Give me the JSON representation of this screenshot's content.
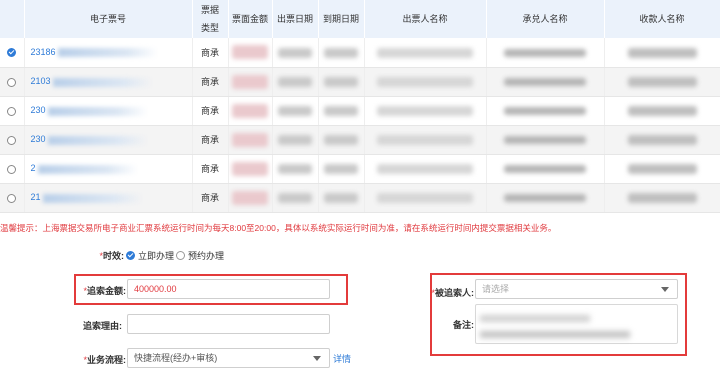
{
  "table": {
    "headers": [
      "",
      "电子票号",
      "票据类型",
      "票面金额",
      "出票日期",
      "到期日期",
      "出票人名称",
      "承兑人名称",
      "收款人名称"
    ],
    "rows": [
      {
        "bill_no": "23186",
        "type": "商承",
        "selected": true
      },
      {
        "bill_no": "2103",
        "type": "商承",
        "selected": false
      },
      {
        "bill_no": "230",
        "type": "商承",
        "selected": false
      },
      {
        "bill_no": "230",
        "type": "商承",
        "selected": false
      },
      {
        "bill_no": "2",
        "type": "商承",
        "selected": false
      },
      {
        "bill_no": "21",
        "type": "商承",
        "selected": false
      }
    ]
  },
  "notice": "温馨提示：上海票据交易所电子商业汇票系统运行时间为每天8:00至20:00，具体以系统实际运行时间为准，请在系统运行时间内提交票据相关业务。",
  "form": {
    "timing": {
      "label": "时效:",
      "options": [
        {
          "label": "立即办理",
          "selected": true
        },
        {
          "label": "预约办理",
          "selected": false
        }
      ]
    },
    "amount": {
      "label": "追索金额:",
      "value": "400000.00"
    },
    "reason": {
      "label": "追索理由:",
      "value": ""
    },
    "process": {
      "label": "业务流程:",
      "value": "快捷流程(经办+审核)",
      "link": "详情"
    },
    "respondent": {
      "label": "被追索人:",
      "placeholder": "请选择"
    },
    "remark": {
      "label": "备注:"
    }
  },
  "colors": {
    "accent": "#2e7bd7",
    "required": "#e0393e",
    "highlight_box": "#e33b3b"
  }
}
